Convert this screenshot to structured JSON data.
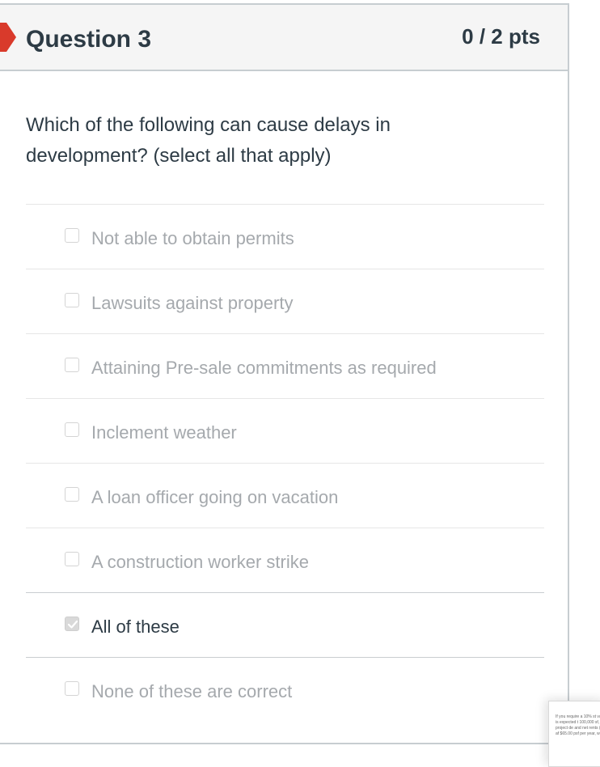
{
  "question": {
    "title": "Question 3",
    "points": "0 / 2 pts",
    "text": "Which of the following can cause delays in development? (select all that apply)"
  },
  "answers": [
    {
      "label": "Not able to obtain permits",
      "checked": false
    },
    {
      "label": "Lawsuits against property",
      "checked": false
    },
    {
      "label": "Attaining Pre-sale commitments as required",
      "checked": false
    },
    {
      "label": "Inclement weather",
      "checked": false
    },
    {
      "label": "A loan officer going on vacation",
      "checked": false
    },
    {
      "label": "A construction worker strike",
      "checked": false
    },
    {
      "label": "All of these",
      "checked": true
    },
    {
      "label": "None of these are correct",
      "checked": false
    }
  ],
  "thumbnail": {
    "text": "If you require a 10% st vacancy is expected t 100,000 sf, project de and net rents (rents af $65.00 psf per year, w"
  },
  "colors": {
    "flag": "#d93a2b",
    "header_bg": "#f5f5f5",
    "text": "#2d3b45",
    "muted_text": "#a5a9ad"
  }
}
